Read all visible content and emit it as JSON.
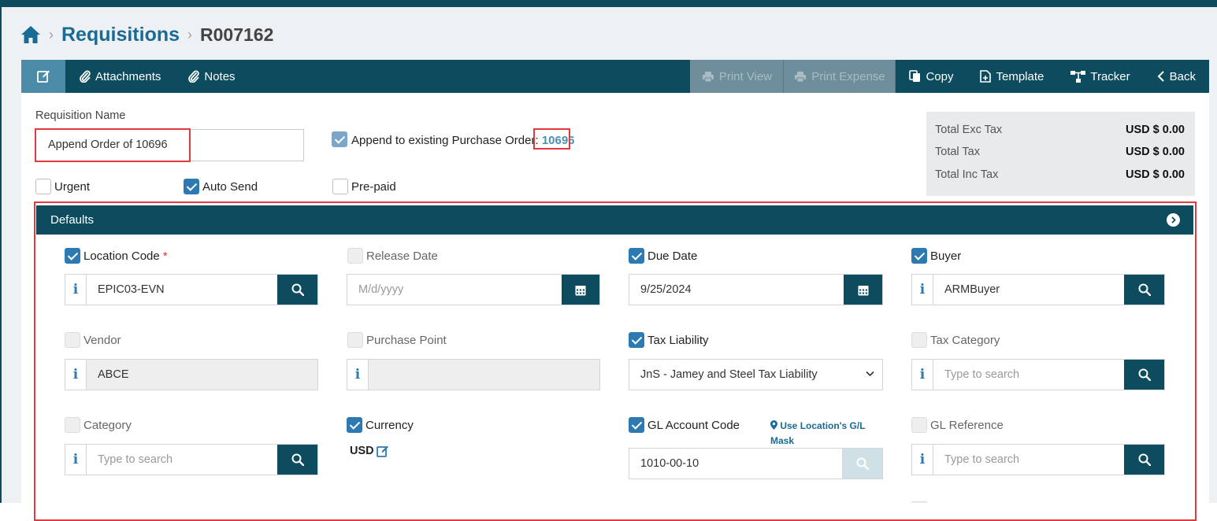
{
  "breadcrumb": {
    "section": "Requisitions",
    "record": "R007162"
  },
  "toolbar": {
    "attachments": "Attachments",
    "notes": "Notes",
    "print_view": "Print View",
    "print_expense": "Print Expense",
    "copy": "Copy",
    "template": "Template",
    "tracker": "Tracker",
    "back": "Back"
  },
  "requisition": {
    "name_label": "Requisition Name",
    "name_value": "Append Order of 10696",
    "append_label": "Append to existing Purchase Order: ",
    "append_po": "10696",
    "append_checked": true,
    "urgent_label": "Urgent",
    "urgent_checked": false,
    "auto_send_label": "Auto Send",
    "auto_send_checked": true,
    "prepaid_label": "Pre-paid",
    "prepaid_checked": false
  },
  "totals": [
    {
      "label": "Total Exc Tax",
      "value": "USD $ 0.00"
    },
    {
      "label": "Total Tax",
      "value": "USD $ 0.00"
    },
    {
      "label": "Total Inc Tax",
      "value": "USD $ 0.00"
    }
  ],
  "defaults": {
    "title": "Defaults",
    "location_code": {
      "label": "Location Code",
      "required_mark": "*",
      "checked": true,
      "value": "EPIC03-EVN"
    },
    "release_date": {
      "label": "Release Date",
      "checked": false,
      "placeholder": "M/d/yyyy"
    },
    "due_date": {
      "label": "Due Date",
      "checked": true,
      "value": "9/25/2024"
    },
    "buyer": {
      "label": "Buyer",
      "checked": true,
      "value": "ARMBuyer"
    },
    "vendor": {
      "label": "Vendor",
      "checked": false,
      "value": "ABCE"
    },
    "purchase_point": {
      "label": "Purchase Point",
      "checked": false,
      "value": ""
    },
    "tax_liability": {
      "label": "Tax Liability",
      "checked": true,
      "value": "JnS - Jamey and Steel Tax Liability"
    },
    "tax_category": {
      "label": "Tax Category",
      "checked": false,
      "placeholder": "Type to search"
    },
    "category": {
      "label": "Category",
      "checked": false,
      "placeholder": "Type to search"
    },
    "currency": {
      "label": "Currency",
      "checked": true,
      "value": "USD"
    },
    "gl_account_code": {
      "label": "GL Account Code",
      "checked": true,
      "value": "1010-00-10",
      "mask_link_line1": "Use Location's G/L",
      "mask_link_line2": "Mask"
    },
    "gl_reference": {
      "label": "GL Reference",
      "checked": false,
      "placeholder": "Type to search"
    }
  },
  "colors": {
    "primary": "#0c4c5e",
    "accent": "#2d7ab3",
    "link": "#1a6a96",
    "highlight_box": "#e0393e"
  },
  "icons": [
    "home-icon",
    "edit-icon",
    "paperclip-icon",
    "printer-icon",
    "copy-icon",
    "template-icon",
    "tracker-icon",
    "chevron-left-icon",
    "search-icon",
    "calendar-icon",
    "chevron-down-icon",
    "map-pin-icon",
    "pencil-square-icon",
    "chevron-right-circle-icon"
  ]
}
